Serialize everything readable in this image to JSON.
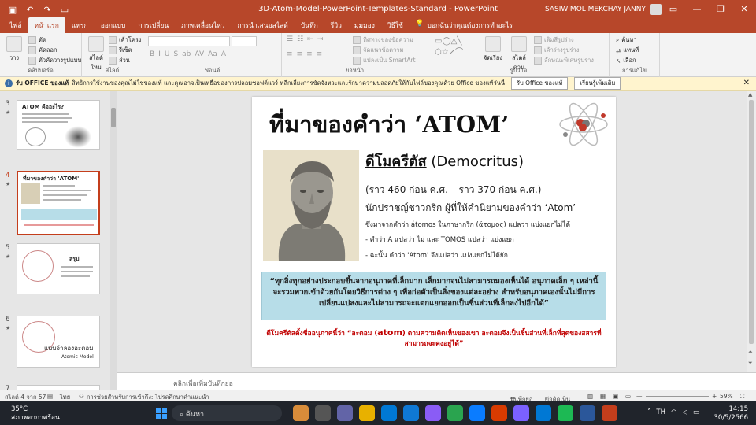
{
  "window": {
    "title": "3D-Atom-Model-PowerPoint-Templates-Standard  -  PowerPoint",
    "user": "SASIWIMOL MEKCHAY JANNY",
    "quick_access": [
      "save-icon",
      "undo-icon",
      "redo-icon",
      "present-icon"
    ],
    "controls": [
      "minimize-icon",
      "restore-icon",
      "close-icon"
    ]
  },
  "ribbon": {
    "tabs": [
      "ไฟล์",
      "หน้าแรก",
      "แทรก",
      "ออกแบบ",
      "การเปลี่ยน",
      "ภาพเคลื่อนไหว",
      "การนำเสนอสไลด์",
      "บันทึก",
      "รีวิว",
      "มุมมอง",
      "วิธีใช้"
    ],
    "active_tab": "หน้าแรก",
    "tell_me": "บอกฉันว่าคุณต้องการทำอะไร",
    "clipboard": {
      "paste": "วาง",
      "cut": "ตัด",
      "copy": "คัดลอก",
      "format_painter": "ตัวคัดวางรูปแบบ",
      "label": "คลิปบอร์ด"
    },
    "slides": {
      "new_slide": "สไลด์ใหม่",
      "layout": "เค้าโครง",
      "reset": "รีเซ็ต",
      "section": "ส่วน",
      "label": "สไลด์"
    },
    "font_label": "ฟอนต์",
    "paragraph": {
      "text_direction": "ทิศทางของข้อความ",
      "align_text": "จัดแนวข้อความ",
      "smartart": "แปลงเป็น SmartArt",
      "label": "ย่อหน้า"
    },
    "drawing": {
      "arrange": "จัดเรียง",
      "quick_styles": "สไตล์ด่วน",
      "fill": "เติมสีรูปร่าง",
      "outline": "เค้าร่างรูปร่าง",
      "effects": "ลักษณะพิเศษรูปร่าง",
      "label": "รูปวาด"
    },
    "editing": {
      "find": "ค้นหา",
      "replace": "แทนที่",
      "select": "เลือก",
      "label": "การแก้ไข"
    }
  },
  "infobar": {
    "title": "รับ OFFICE ของแท้",
    "message": "สิทธิการใช้งานของคุณไม่ใช่ของแท้ และคุณอาจเป็นเหยื่อของการปลอมซอฟต์แวร์ หลีกเลี่ยงการขัดจังหวะและรักษาความปลอดภัยให้กับไฟล์ของคุณด้วย Office ของแท้วันนี้",
    "primary_button": "รับ Office ของแท้",
    "secondary_button": "เรียนรู้เพิ่มเติม"
  },
  "thumbnails": [
    {
      "num": "3",
      "title": "ATOM คืออะไร?",
      "starred": true,
      "selected": false
    },
    {
      "num": "4",
      "title": "ที่มาของคำว่า 'ATOM'",
      "starred": true,
      "selected": true
    },
    {
      "num": "5",
      "title": "สรุป",
      "starred": true,
      "selected": false
    },
    {
      "num": "6",
      "title": "แบบจำลองอะตอม",
      "subtitle": "Atomic Model",
      "starred": true,
      "selected": false
    },
    {
      "num": "7",
      "title": "",
      "starred": false,
      "selected": false
    }
  ],
  "slide": {
    "title": "ที่มาของคำว่า ‘ATOM’",
    "name_thai": "ดีโมครีตัส",
    "name_en": " (Democritus)",
    "dates": "(ราว 460 ก่อน ค.ศ. – ราว 370 ก่อน ค.ศ.)",
    "line1": "นักปราชญ์ชาวกรีก ผู้ที่ให้คำนิยามของคำว่า  ‘Atom’",
    "line2": "ซึ่งมาจากคำว่า átomos ในภาษากรีก (ἄτομος) แปลว่า แบ่งแยกไม่ได้",
    "line3": "-    คำว่า A แปลว่า ไม่  และ  TOMOS แปลว่า แบ่งแยก",
    "line4": "-    ฉะนั้น คำว่า 'Atom' จึงแปลว่า แบ่งแยกไม่ได้ยัก",
    "quote": "“ทุกสิ่งทุกอย่างประกอบขึ้นจากอนุภาคที่เล็กมาก  เล็กมากจนไม่สามารถมองเห็นได้  อนุภาคเล็ก ๆ เหล่านี้จะรวมพวกเข้าด้วยกันโดยวิธีการต่าง ๆ เพื่อก่อตัวเป็นสิ่งของแต่ละอย่าง  สำหรับอนุภาคเองนั้นไม่มีการเปลี่ยนแปลงและไม่สามารถจะแตกแยกออกเป็นชิ้นส่วนที่เล็กลงไปอีกได้”",
    "note_a": "ดีโมครีตัสตั้งชื่ออนุภาคนี้ว่า “อะตอม (",
    "note_atom": "atom",
    "note_b": ")  ตามความคิดเห็นของเขา อะตอมจึงเป็นชิ้นส่วนที่เล็กที่สุดของสสารที่สามารถจะคงอยู่ได้”"
  },
  "notes_placeholder": "คลิกเพื่อเพิ่มบันทึกย่อ",
  "status": {
    "slide_count": "สไลด์ 4 จาก 57",
    "language": "ไทย",
    "accessibility": "การช่วยสำหรับการเข้าถึง: โปรดศึกษาคำแนะนำ",
    "notes": "บันทึกย่อ",
    "comments": "ข้อคิดเห็น",
    "zoom": "59%"
  },
  "taskbar": {
    "temp": "35°C",
    "weather": "สภาพอากาศร้อน",
    "search": "ค้นหา",
    "lang": "TH",
    "time": "14:15",
    "date": "30/5/2566"
  }
}
